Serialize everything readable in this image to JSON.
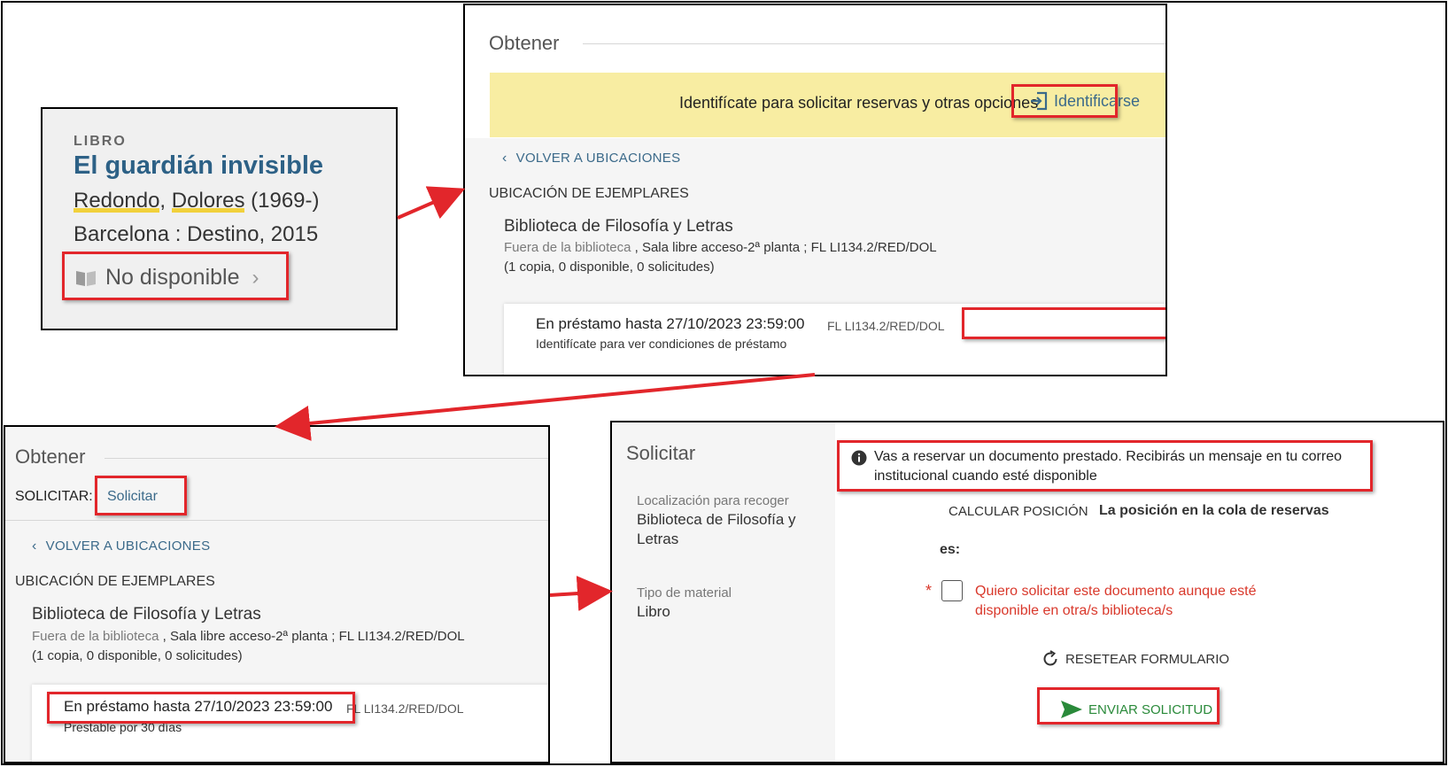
{
  "record": {
    "type": "LIBRO",
    "title": "El guardián invisible",
    "author_surname": "Redondo",
    "author_sep": ", ",
    "author_name": "Dolores",
    "author_dates": " (1969-)",
    "publication": "Barcelona : Destino, 2015",
    "availability": "No disponible"
  },
  "get_panel": {
    "header": "Obtener",
    "login_prompt": "Identifícate para solicitar reservas y otras opciones",
    "login_link": "Identificarse",
    "back_link": "VOLVER A UBICACIONES",
    "locations_heading": "UBICACIÓN DE EJEMPLARES",
    "library_name": "Biblioteca de Filosofía y Letras",
    "location_sub": "Fuera de la biblioteca",
    "location_detail": " , Sala libre acceso-2ª planta ; FL LI134.2/RED/DOL",
    "copies": "(1 copia, 0 disponible, 0 solicitudes)",
    "loan_status": "En préstamo hasta 27/10/2023 23:59:00",
    "call_number": "FL LI134.2/RED/DOL",
    "loan_conditions": "Identifícate para ver condiciones de préstamo"
  },
  "get_panel_logged": {
    "header": "Obtener",
    "request_label": "SOLICITAR:",
    "request_link": "Solicitar",
    "back_link": "VOLVER A UBICACIONES",
    "locations_heading": "UBICACIÓN DE EJEMPLARES",
    "library_name": "Biblioteca de Filosofía y Letras",
    "location_sub": "Fuera de la biblioteca",
    "location_detail": " , Sala libre acceso-2ª planta ; FL LI134.2/RED/DOL",
    "copies": "(1 copia, 0 disponible, 0 solicitudes)",
    "loan_status": "En préstamo hasta 27/10/2023 23:59:00",
    "call_number": "FL LI134.2/RED/DOL",
    "loan_conditions": "Prestable por 30 días"
  },
  "request_form": {
    "header": "Solicitar",
    "pickup_label": "Localización para recoger",
    "pickup_value_line1": "Biblioteca de Filosofía y",
    "pickup_value_line2": "Letras",
    "material_label": "Tipo de material",
    "material_value": "Libro",
    "info_line1": "Vas a reservar un documento prestado. Recibirás un mensaje en tu correo",
    "info_line2": "institucional cuando esté disponible",
    "calc_position": "CALCULAR POSICIÓN",
    "queue_text": "La posición en la cola de reservas",
    "queue_es": "es:",
    "required_mark": "*",
    "checkbox_line1": "Quiero solicitar este documento aunque esté",
    "checkbox_line2": "disponible en otra/s biblioteca/s",
    "reset_button": "RESETEAR FORMULARIO",
    "submit_button": "ENVIAR SOLICITUD"
  },
  "colors": {
    "annotation_red": "#e2262b",
    "link_blue": "#3b6a8a",
    "banner_yellow": "#f8eda2",
    "submit_green": "#2a8a3a"
  }
}
